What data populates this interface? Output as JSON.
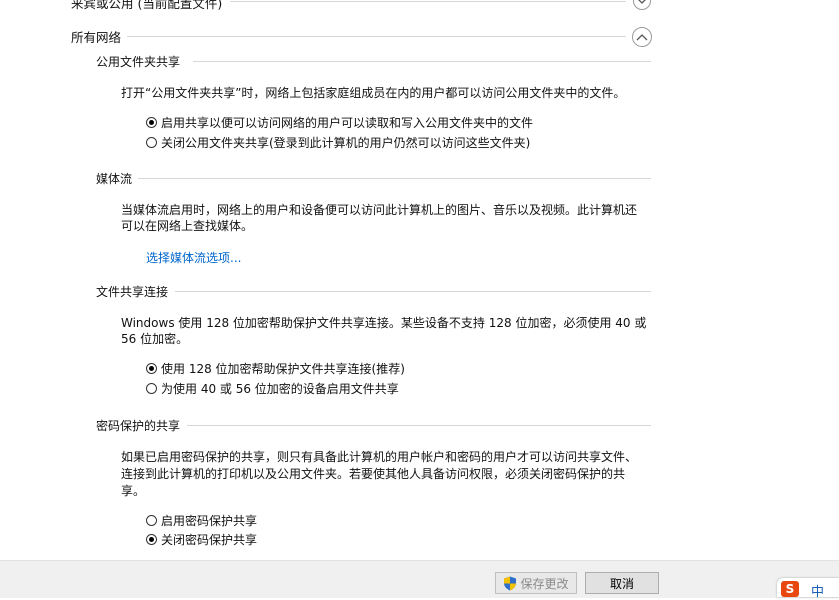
{
  "profiles": {
    "previous_title": "来宾或公用 (当前配置文件)",
    "all_networks_title": "所有网络"
  },
  "public_folder": {
    "title": "公用文件夹共享",
    "description": "打开“公用文件夹共享”时，网络上包括家庭组成员在内的用户都可以访问公用文件夹中的文件。",
    "options": [
      {
        "label": "启用共享以便可以访问网络的用户可以读取和写入公用文件夹中的文件",
        "checked": true
      },
      {
        "label": "关闭公用文件夹共享(登录到此计算机的用户仍然可以访问这些文件夹)",
        "checked": false
      }
    ]
  },
  "media_streaming": {
    "title": "媒体流",
    "description_line1": "当媒体流启用时，网络上的用户和设备便可以访问此计算机上的图片、音乐以及视频。此计算机还",
    "description_line2": "可以在网络上查找媒体。",
    "link": "选择媒体流选项..."
  },
  "file_sharing": {
    "title": "文件共享连接",
    "description_line1": "Windows 使用 128 位加密帮助保护文件共享连接。某些设备不支持 128 位加密，必须使用 40 或",
    "description_line2": "56 位加密。",
    "options": [
      {
        "label": "使用 128 位加密帮助保护文件共享连接(推荐)",
        "checked": true
      },
      {
        "label": "为使用 40 或 56 位加密的设备启用文件共享",
        "checked": false
      }
    ]
  },
  "password_sharing": {
    "title": "密码保护的共享",
    "description_line1": "如果已启用密码保护的共享，则只有具备此计算机的用户帐户和密码的用户才可以访问共享文件、",
    "description_line2": "连接到此计算机的打印机以及公用文件夹。若要使其他人具备访问权限，必须关闭密码保护的共",
    "description_line3": "享。",
    "options": [
      {
        "label": "启用密码保护共享",
        "checked": false
      },
      {
        "label": "关闭密码保护共享",
        "checked": true
      }
    ]
  },
  "footer": {
    "save_label": "保存更改",
    "cancel_label": "取消"
  },
  "taskbar": {
    "ime_label": "中"
  },
  "colors": {
    "link": "#0066cc",
    "shield_blue": "#2f6fc9",
    "shield_yellow": "#f2c200",
    "ime_red": "#e8470f"
  }
}
